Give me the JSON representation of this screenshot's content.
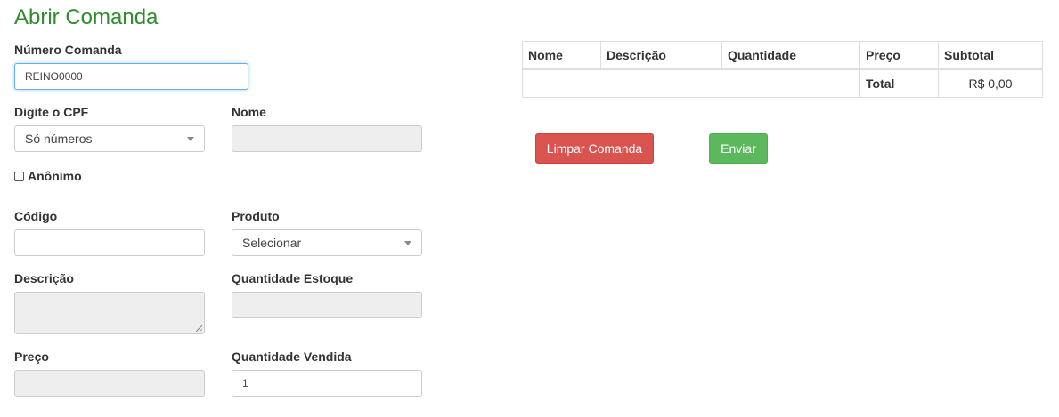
{
  "page": {
    "title": "Abrir Comanda"
  },
  "form": {
    "numero_comanda": {
      "label": "Número Comanda",
      "value": "REINO0000"
    },
    "cpf": {
      "label": "Digite o CPF",
      "selected": "Só números"
    },
    "nome": {
      "label": "Nome",
      "value": ""
    },
    "anonimo": {
      "label": "Anônimo",
      "checked": false
    },
    "codigo": {
      "label": "Código",
      "value": ""
    },
    "produto": {
      "label": "Produto",
      "selected": "Selecionar"
    },
    "descricao": {
      "label": "Descrição",
      "value": ""
    },
    "quantidade_estoque": {
      "label": "Quantidade Estoque",
      "value": ""
    },
    "preco": {
      "label": "Preço",
      "value": ""
    },
    "quantidade_vendida": {
      "label": "Quantidade Vendida",
      "value": "1"
    }
  },
  "table": {
    "columns": [
      "Nome",
      "Descrição",
      "Quantidade",
      "Preço",
      "Subtotal"
    ],
    "total_label": "Total",
    "total_value": "R$ 0,00"
  },
  "buttons": {
    "limpar": "Limpar Comanda",
    "enviar": "Enviar"
  },
  "colors": {
    "title": "#2e8b2e",
    "danger": "#d9534f",
    "success": "#5cb85c",
    "focus": "#66afe9"
  },
  "icons": {
    "dropdown": "caret-down-icon",
    "textarea_resize": "resize-handle-icon"
  }
}
